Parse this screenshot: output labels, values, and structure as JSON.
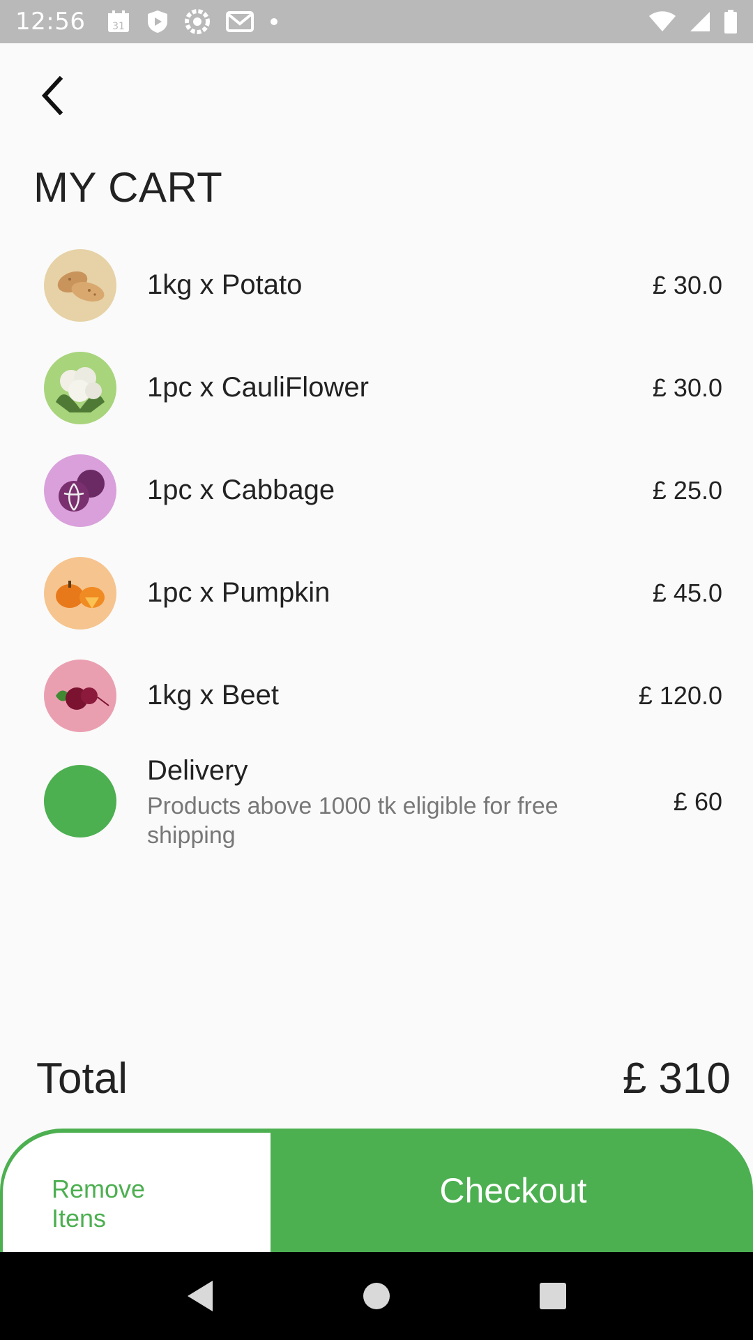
{
  "status_bar": {
    "time": "12:56",
    "left_icons": [
      "calendar-icon",
      "shield-icon",
      "settings-cog-icon",
      "gmail-icon",
      "dot-icon"
    ],
    "calendar_day": "31",
    "right_icons": [
      "wifi-icon",
      "signal-icon",
      "battery-icon"
    ]
  },
  "header": {
    "back_icon": "chevron-left-icon",
    "title": "MY CART"
  },
  "cart": {
    "items": [
      {
        "label": "1kg x Potato",
        "price": "£ 30.0",
        "thumb_color": "#e6d2a6",
        "icon": "potato-icon"
      },
      {
        "label": "1pc x CauliFlower",
        "price": "£ 30.0",
        "thumb_color": "#a8d47c",
        "icon": "cauliflower-icon"
      },
      {
        "label": "1pc x Cabbage",
        "price": "£ 25.0",
        "thumb_color": "#d9a0dc",
        "icon": "cabbage-icon"
      },
      {
        "label": "1pc x Pumpkin",
        "price": "£ 45.0",
        "thumb_color": "#f6c48e",
        "icon": "pumpkin-icon"
      },
      {
        "label": "1kg x Beet",
        "price": "£ 120.0",
        "thumb_color": "#ea9fb0",
        "icon": "beet-icon"
      }
    ],
    "delivery": {
      "title": "Delivery",
      "note": "Products above 1000 tk eligible for free shipping",
      "price": "£ 60",
      "dot_color": "#4caf50"
    }
  },
  "summary": {
    "total_label": "Total",
    "total_value": "£ 310"
  },
  "actions": {
    "remove_label": "Remove Itens",
    "checkout_label": "Checkout",
    "accent_color": "#4caf50"
  },
  "nav": {
    "icons": [
      "nav-back-icon",
      "nav-home-icon",
      "nav-recents-icon"
    ]
  }
}
